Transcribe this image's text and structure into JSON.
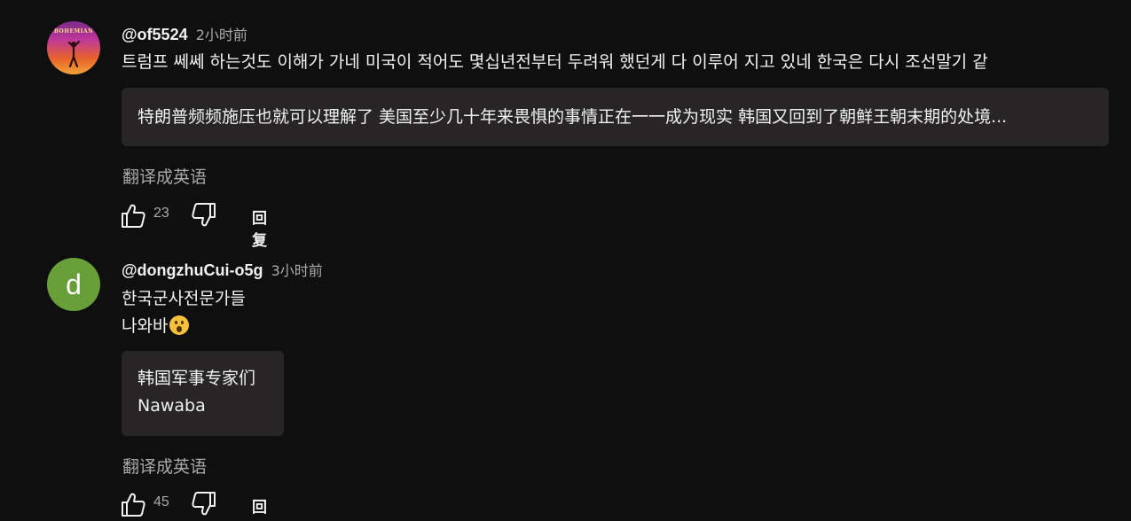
{
  "comments": [
    {
      "author": "@of5524",
      "time": "2小时前",
      "avatar_type": "poster",
      "avatar_text": "BOHEMIAN",
      "body_lines": [
        "트럼프 쎄쎄 하는것도 이해가 가네 미국이 적어도 몇십년전부터 두려워 했던게 다 이루어 지고 있네  한국은 다시 조선말기 같"
      ],
      "translation": "特朗普频频施压也就可以理解了 美国至少几十年来畏惧的事情正在一一成为现实 韩国又回到了朝鲜王朝末期的处境...",
      "translate_label": "翻译成英语",
      "likes": "23",
      "reply_label": "回复"
    },
    {
      "author": "@dongzhuCui-o5g",
      "time": "3小时前",
      "avatar_type": "letter",
      "avatar_letter": "d",
      "avatar_color": "#689f38",
      "body_lines": [
        "한국군사전문가들",
        "나와바"
      ],
      "body_emoji": "astonished-face-emoji",
      "translation_lines": [
        "韩国军事专家们",
        "Nawaba"
      ],
      "translate_label": "翻译成英语",
      "likes": "45",
      "reply_label": "回复"
    }
  ],
  "colors": {
    "background": "#0f0f0f",
    "text": "#f1f1f1",
    "secondary_text": "#aaaaaa",
    "translation_bg": "#272525"
  },
  "icons": {
    "like": "thumbs-up-icon",
    "dislike": "thumbs-down-icon"
  }
}
